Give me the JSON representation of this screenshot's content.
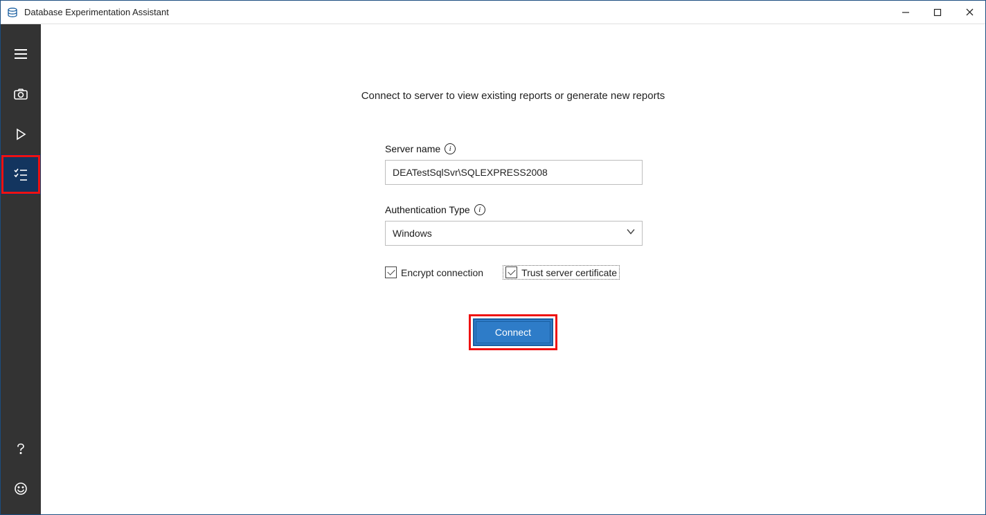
{
  "titlebar": {
    "title": "Database Experimentation Assistant"
  },
  "sidebar": {
    "items": [
      {
        "name": "menu",
        "icon": "hamburger"
      },
      {
        "name": "capture",
        "icon": "camera"
      },
      {
        "name": "replay",
        "icon": "play"
      },
      {
        "name": "reports",
        "icon": "checklist",
        "active": true
      }
    ],
    "bottom": [
      {
        "name": "help",
        "icon": "question"
      },
      {
        "name": "feedback",
        "icon": "smiley"
      }
    ]
  },
  "main": {
    "instruction": "Connect to server to view existing reports or generate new reports",
    "server_name_label": "Server name",
    "server_name_value": "DEATestSqlSvr\\SQLEXPRESS2008",
    "auth_type_label": "Authentication Type",
    "auth_type_value": "Windows",
    "encrypt_label": "Encrypt connection",
    "encrypt_checked": true,
    "trust_label": "Trust server certificate",
    "trust_checked": true,
    "connect_label": "Connect"
  }
}
